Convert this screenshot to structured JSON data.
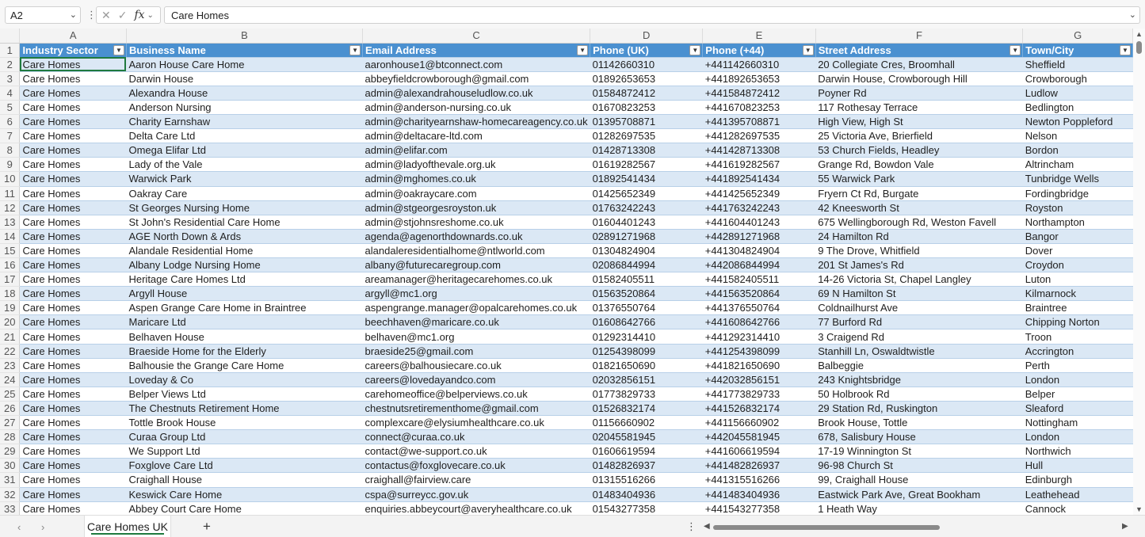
{
  "formula_bar": {
    "name_box": "A2",
    "formula": "Care Homes",
    "fx_label": "fx",
    "cancel_glyph": "✕",
    "enter_glyph": "✓"
  },
  "columns": [
    "A",
    "B",
    "C",
    "D",
    "E",
    "F",
    "G"
  ],
  "headers": [
    "Industry Sector",
    "Business Name",
    "Email Address",
    "Phone (UK)",
    "Phone (+44)",
    "Street Address",
    "Town/City"
  ],
  "rows": [
    [
      "Care Homes",
      "Aaron House Care Home",
      "aaronhouse1@btconnect.com",
      "01142660310",
      "+441142660310",
      "20 Collegiate Cres, Broomhall",
      "Sheffield"
    ],
    [
      "Care Homes",
      "Darwin House",
      "abbeyfieldcrowborough@gmail.com",
      "01892653653",
      "+441892653653",
      "Darwin House, Crowborough Hill",
      "Crowborough"
    ],
    [
      "Care Homes",
      "Alexandra House",
      "admin@alexandrahouseludlow.co.uk",
      "01584872412",
      "+441584872412",
      "Poyner Rd",
      "Ludlow"
    ],
    [
      "Care Homes",
      "Anderson Nursing",
      "admin@anderson-nursing.co.uk",
      "01670823253",
      "+441670823253",
      "117 Rothesay Terrace",
      "Bedlington"
    ],
    [
      "Care Homes",
      "Charity Earnshaw",
      "admin@charityearnshaw-homecareagency.co.uk",
      "01395708871",
      "+441395708871",
      "High View, High St",
      "Newton Poppleford"
    ],
    [
      "Care Homes",
      "Delta Care Ltd",
      "admin@deltacare-ltd.com",
      "01282697535",
      "+441282697535",
      "25 Victoria Ave, Brierfield",
      "Nelson"
    ],
    [
      "Care Homes",
      "Omega Elifar Ltd",
      "admin@elifar.com",
      "01428713308",
      "+441428713308",
      "53 Church Fields, Headley",
      "Bordon"
    ],
    [
      "Care Homes",
      "Lady of the Vale",
      "admin@ladyofthevale.org.uk",
      "01619282567",
      "+441619282567",
      "Grange Rd, Bowdon Vale",
      "Altrincham"
    ],
    [
      "Care Homes",
      "Warwick Park",
      "admin@mghomes.co.uk",
      "01892541434",
      "+441892541434",
      "55 Warwick Park",
      "Tunbridge Wells"
    ],
    [
      "Care Homes",
      "Oakray Care",
      "admin@oakraycare.com",
      "01425652349",
      "+441425652349",
      "Fryern Ct Rd, Burgate",
      "Fordingbridge"
    ],
    [
      "Care Homes",
      "St Georges Nursing Home",
      "admin@stgeorgesroyston.uk",
      "01763242243",
      "+441763242243",
      "42 Kneesworth St",
      "Royston"
    ],
    [
      "Care Homes",
      "St John's Residential Care Home",
      "admin@stjohnsreshome.co.uk",
      "01604401243",
      "+441604401243",
      "675 Wellingborough Rd, Weston Favell",
      "Northampton"
    ],
    [
      "Care Homes",
      "AGE North Down & Ards",
      "agenda@agenorthdownards.co.uk",
      "02891271968",
      "+442891271968",
      "24 Hamilton Rd",
      "Bangor"
    ],
    [
      "Care Homes",
      "Alandale Residential Home",
      "alandaleresidentialhome@ntlworld.com",
      "01304824904",
      "+441304824904",
      "9 The Drove, Whitfield",
      "Dover"
    ],
    [
      "Care Homes",
      "Albany Lodge Nursing Home",
      "albany@futurecaregroup.com",
      "02086844994",
      "+442086844994",
      "201 St James's Rd",
      "Croydon"
    ],
    [
      "Care Homes",
      "Heritage Care Homes Ltd",
      "areamanager@heritagecarehomes.co.uk",
      "01582405511",
      "+441582405511",
      "14-26 Victoria St, Chapel Langley",
      "Luton"
    ],
    [
      "Care Homes",
      "Argyll House",
      "argyll@mc1.org",
      "01563520864",
      "+441563520864",
      "69 N Hamilton St",
      "Kilmarnock"
    ],
    [
      "Care Homes",
      "Aspen Grange Care Home in Braintree",
      "aspengrange.manager@opalcarehomes.co.uk",
      "01376550764",
      "+441376550764",
      "Coldnailhurst Ave",
      "Braintree"
    ],
    [
      "Care Homes",
      "Maricare Ltd",
      "beechhaven@maricare.co.uk",
      "01608642766",
      "+441608642766",
      "77 Burford Rd",
      "Chipping Norton"
    ],
    [
      "Care Homes",
      "Belhaven House",
      "belhaven@mc1.org",
      "01292314410",
      "+441292314410",
      "3 Craigend Rd",
      "Troon"
    ],
    [
      "Care Homes",
      "Braeside Home for the Elderly",
      "braeside25@gmail.com",
      "01254398099",
      "+441254398099",
      "Stanhill Ln, Oswaldtwistle",
      "Accrington"
    ],
    [
      "Care Homes",
      "Balhousie the Grange Care Home",
      "careers@balhousiecare.co.uk",
      "01821650690",
      "+441821650690",
      "Balbeggie",
      "Perth"
    ],
    [
      "Care Homes",
      "Loveday & Co",
      "careers@lovedayandco.com",
      "02032856151",
      "+442032856151",
      "243 Knightsbridge",
      "London"
    ],
    [
      "Care Homes",
      "Belper Views Ltd",
      "carehomeoffice@belperviews.co.uk",
      "01773829733",
      "+441773829733",
      "50 Holbrook Rd",
      "Belper"
    ],
    [
      "Care Homes",
      "The Chestnuts Retirement Home",
      "chestnutsretirementhome@gmail.com",
      "01526832174",
      "+441526832174",
      "29 Station Rd, Ruskington",
      "Sleaford"
    ],
    [
      "Care Homes",
      "Tottle Brook House",
      "complexcare@elysiumhealthcare.co.uk",
      "01156660902",
      "+441156660902",
      "Brook House, Tottle",
      "Nottingham"
    ],
    [
      "Care Homes",
      "Curaa Group Ltd",
      "connect@curaa.co.uk",
      "02045581945",
      "+442045581945",
      "678, Salisbury House",
      "London"
    ],
    [
      "Care Homes",
      "We Support Ltd",
      "contact@we-support.co.uk",
      "01606619594",
      "+441606619594",
      "17-19 Winnington St",
      "Northwich"
    ],
    [
      "Care Homes",
      "Foxglove Care Ltd",
      "contactus@foxglovecare.co.uk",
      "01482826937",
      "+441482826937",
      "96-98 Church St",
      "Hull"
    ],
    [
      "Care Homes",
      "Craighall House",
      "craighall@fairview.care",
      "01315516266",
      "+441315516266",
      "99, Craighall House",
      "Edinburgh"
    ],
    [
      "Care Homes",
      "Keswick Care Home",
      "cspa@surreycc.gov.uk",
      "01483404936",
      "+441483404936",
      "Eastwick Park Ave, Great Bookham",
      "Leathehead"
    ],
    [
      "Care Homes",
      "Abbey Court Care Home",
      "enquiries.abbeycourt@averyhealthcare.co.uk",
      "01543277358",
      "+441543277358",
      "1 Heath Way",
      "Cannock"
    ]
  ],
  "sheet_tabs": [
    "Care Homes UK"
  ],
  "colors": {
    "header_fill": "#4a90d0",
    "band_fill": "#dbe8f5",
    "selection": "#1f7a3f"
  }
}
